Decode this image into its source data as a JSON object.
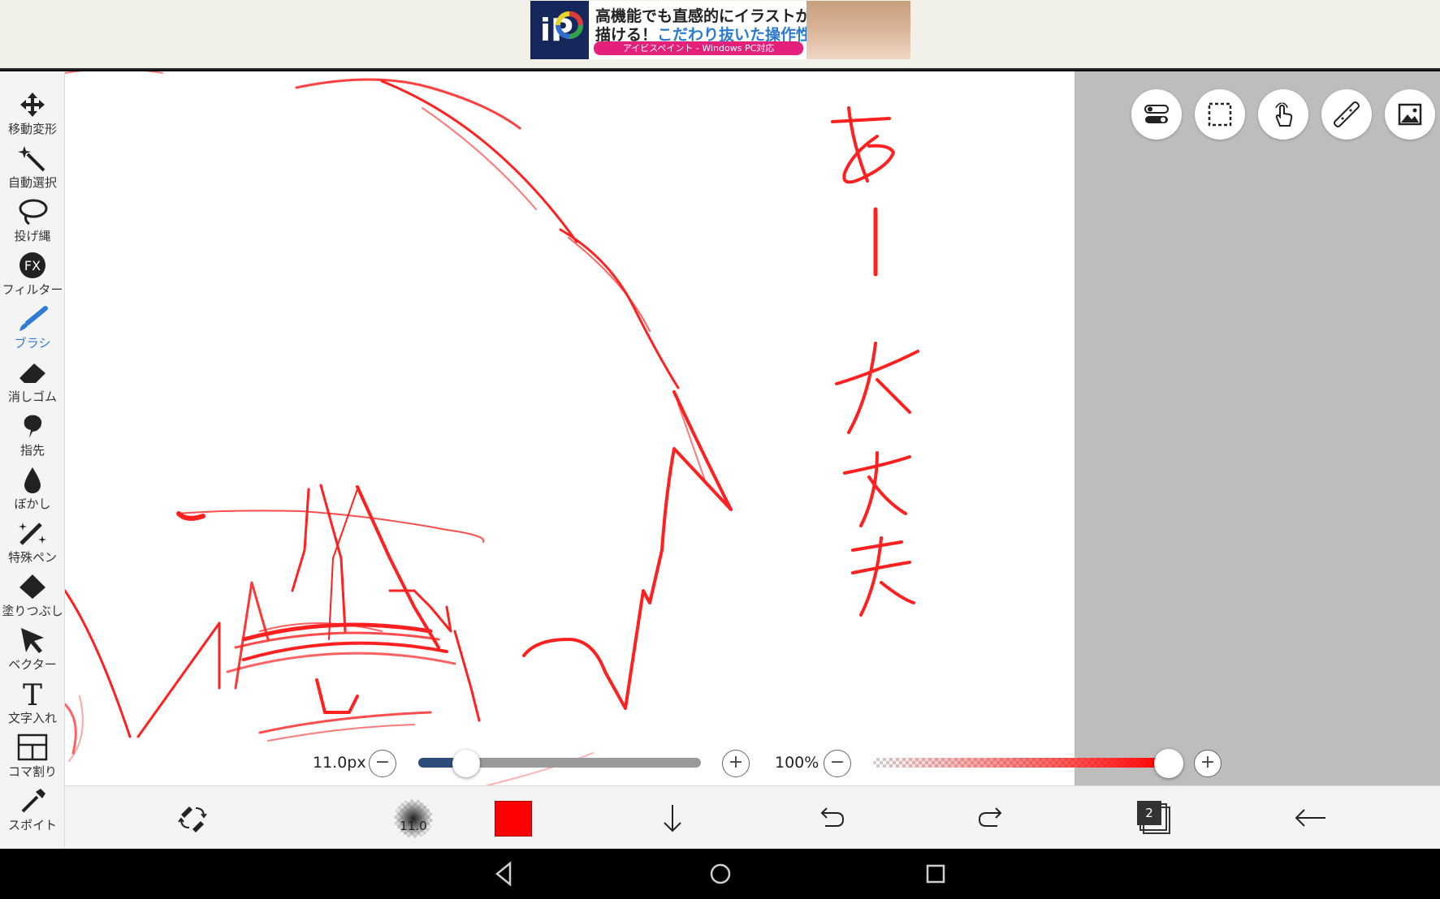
{
  "ad": {
    "logo_text": "iP",
    "line1": "高機能でも直感的にイラストが",
    "line2_a": "描ける！",
    "line2_b": "こだわり抜いた操作性！",
    "line3": "アイビスペイント - Windows PC対応"
  },
  "toolbar": {
    "tools": [
      {
        "label": "移動変形",
        "icon": "move-icon"
      },
      {
        "label": "自動選択",
        "icon": "magic-wand-icon"
      },
      {
        "label": "投げ縄",
        "icon": "lasso-icon"
      },
      {
        "label": "フィルター",
        "icon": "fx-icon",
        "icon_text": "FX"
      },
      {
        "label": "ブラシ",
        "icon": "brush-icon",
        "active": true
      },
      {
        "label": "消しゴム",
        "icon": "eraser-icon"
      },
      {
        "label": "指先",
        "icon": "smudge-icon"
      },
      {
        "label": "ぼかし",
        "icon": "blur-icon"
      },
      {
        "label": "特殊ペン",
        "icon": "special-pen-icon"
      },
      {
        "label": "塗りつぶし",
        "icon": "fill-icon"
      },
      {
        "label": "ベクター",
        "icon": "vector-icon"
      },
      {
        "label": "文字入れ",
        "icon": "text-icon",
        "icon_text": "T"
      },
      {
        "label": "コマ割り",
        "icon": "frame-divider-icon"
      },
      {
        "label": "スポイト",
        "icon": "eyedropper-icon"
      }
    ]
  },
  "brush": {
    "size_label": "11.0px",
    "size_fraction": 0.17,
    "preview_size": "11.0",
    "color": "#ff0000"
  },
  "opacity": {
    "label": "100%",
    "value_fraction": 1.0
  },
  "bottom_bar": {
    "layer_count": "2"
  },
  "colors": {
    "stroke": "#ff0000",
    "accent": "#2e7bd6",
    "slider_fill": "#2c4e78"
  }
}
